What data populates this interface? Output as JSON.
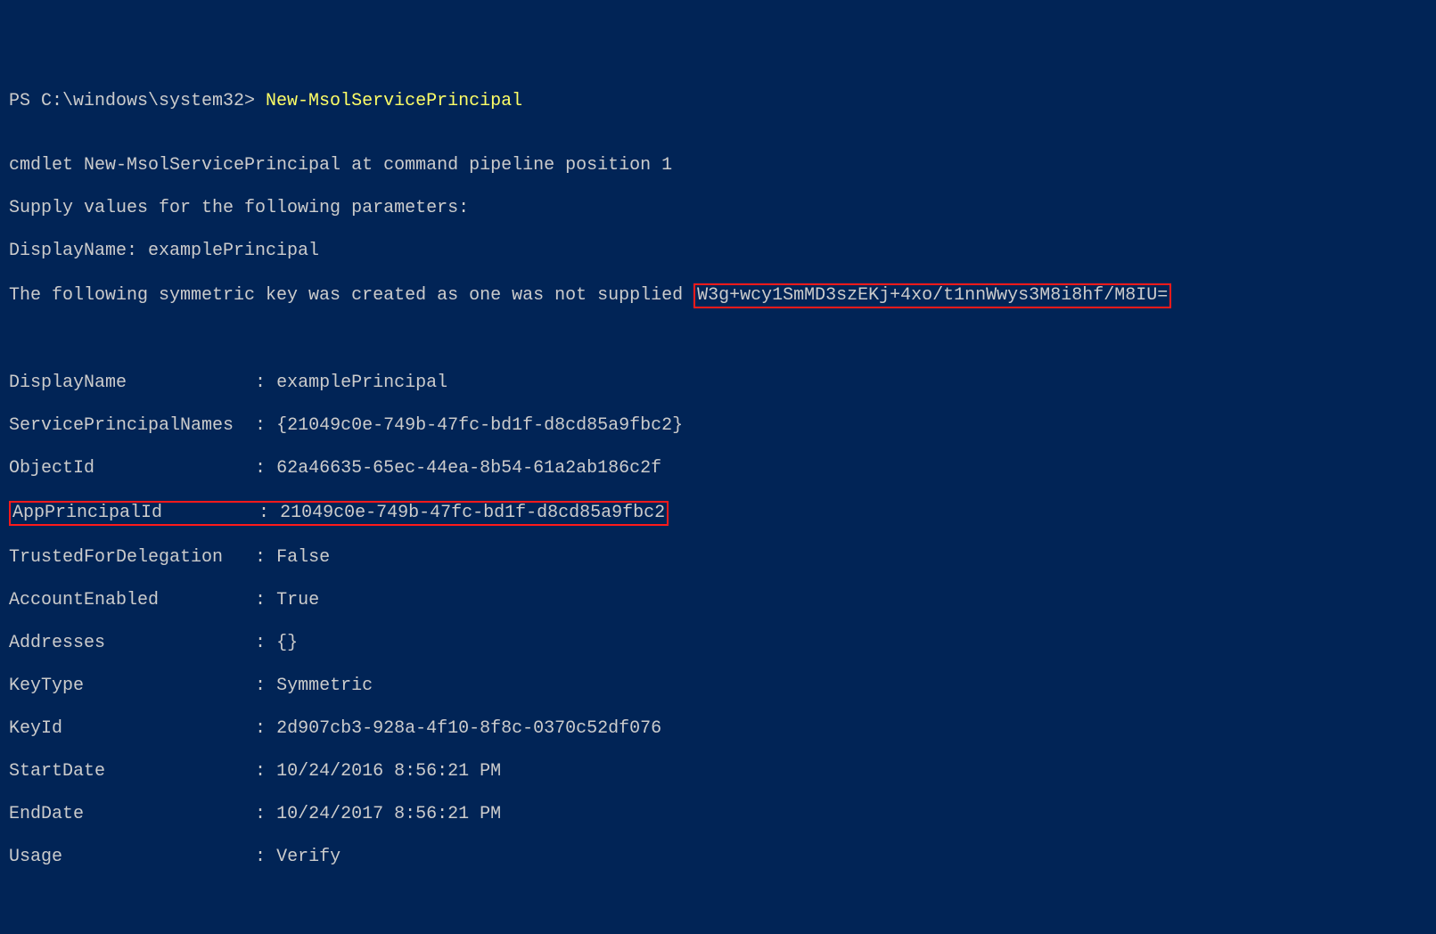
{
  "prompt": {
    "prefix": "PS C:\\windows\\system32> ",
    "command": "New-MsolServicePrincipal"
  },
  "messages": {
    "line1": "cmdlet New-MsolServicePrincipal at command pipeline position 1",
    "line2": "Supply values for the following parameters:",
    "line3_label": "DisplayName: ",
    "line3_value": "examplePrincipal",
    "line4_prefix": "The following symmetric key was created as one was not supplied ",
    "line4_key": "W3g+wcy1SmMD3szEKj+4xo/t1nnWwys3M8i8hf/M8IU="
  },
  "details": {
    "DisplayName": {
      "label": "DisplayName           ",
      "sep": " : ",
      "value": "examplePrincipal"
    },
    "ServicePrincipalNames": {
      "label": "ServicePrincipalNames ",
      "sep": " : ",
      "value": "{21049c0e-749b-47fc-bd1f-d8cd85a9fbc2}"
    },
    "ObjectId": {
      "label": "ObjectId              ",
      "sep": " : ",
      "value": "62a46635-65ec-44ea-8b54-61a2ab186c2f"
    },
    "AppPrincipalId": {
      "label": "AppPrincipalId        ",
      "sep": " : ",
      "value": "21049c0e-749b-47fc-bd1f-d8cd85a9fbc2"
    },
    "TrustedForDelegation": {
      "label": "TrustedForDelegation  ",
      "sep": " : ",
      "value": "False"
    },
    "AccountEnabled": {
      "label": "AccountEnabled        ",
      "sep": " : ",
      "value": "True"
    },
    "Addresses": {
      "label": "Addresses             ",
      "sep": " : ",
      "value": "{}"
    },
    "KeyType": {
      "label": "KeyType               ",
      "sep": " : ",
      "value": "Symmetric"
    },
    "KeyId": {
      "label": "KeyId                 ",
      "sep": " : ",
      "value": "2d907cb3-928a-4f10-8f8c-0370c52df076"
    },
    "StartDate": {
      "label": "StartDate             ",
      "sep": " : ",
      "value": "10/24/2016 8:56:21 PM"
    },
    "EndDate": {
      "label": "EndDate               ",
      "sep": " : ",
      "value": "10/24/2017 8:56:21 PM"
    },
    "Usage": {
      "label": "Usage                 ",
      "sep": " : ",
      "value": "Verify"
    }
  }
}
